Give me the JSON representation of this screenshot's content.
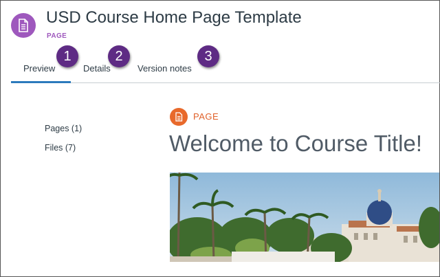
{
  "header": {
    "title": "USD Course Home Page Template",
    "type_label": "PAGE",
    "icon": "document-icon",
    "accent_color": "#9e58bd"
  },
  "tabs": [
    {
      "label": "Preview",
      "active": true,
      "badge": "1"
    },
    {
      "label": "Details",
      "active": false,
      "badge": "2"
    },
    {
      "label": "Version notes",
      "active": false,
      "badge": "3"
    }
  ],
  "tab_active_color": "#2b7abc",
  "badge_color": "#5e2b84",
  "sidebar": {
    "items": [
      {
        "label": "Pages (1)"
      },
      {
        "label": "Files (7)"
      }
    ]
  },
  "preview": {
    "type_label": "PAGE",
    "type_icon": "document-icon",
    "type_color": "#e8692b",
    "heading": "Welcome to Course Title!",
    "image": "campus-photo"
  }
}
